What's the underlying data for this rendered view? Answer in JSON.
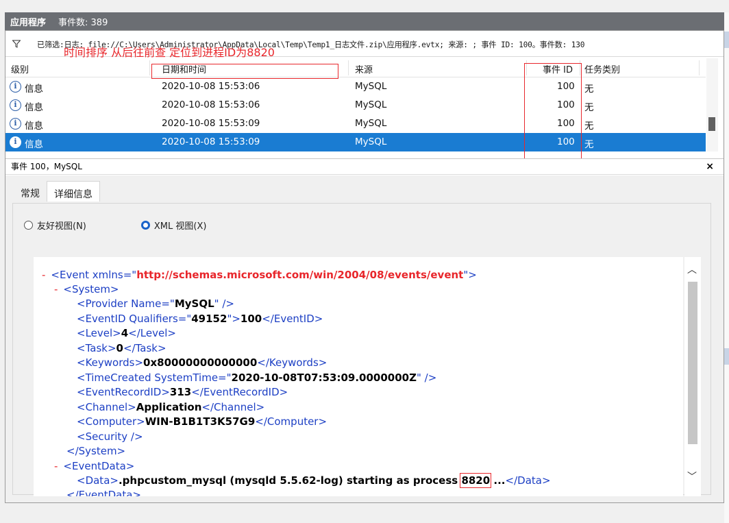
{
  "title": {
    "app": "应用程序",
    "count": "事件数: 389"
  },
  "filter": {
    "text": "已筛选:日志: file://C:\\Users\\Administrator\\AppData\\Local\\Temp\\Temp1_日志文件.zip\\应用程序.evtx; 来源: ; 事件 ID: 100。事件数: 130"
  },
  "annotation": {
    "note": "时间排序 从后往前查 定位到进程ID为8820"
  },
  "grid": {
    "columns": {
      "level": "级别",
      "datetime": "日期和时间",
      "source": "来源",
      "eventid": "事件 ID",
      "task": "任务类别"
    },
    "rows": [
      {
        "level": "信息",
        "datetime": "2020-10-08 15:53:06",
        "source": "MySQL",
        "eventid": "100",
        "task": "无"
      },
      {
        "level": "信息",
        "datetime": "2020-10-08 15:53:06",
        "source": "MySQL",
        "eventid": "100",
        "task": "无"
      },
      {
        "level": "信息",
        "datetime": "2020-10-08 15:53:09",
        "source": "MySQL",
        "eventid": "100",
        "task": "无"
      },
      {
        "level": "信息",
        "datetime": "2020-10-08 15:53:09",
        "source": "MySQL",
        "eventid": "100",
        "task": "无"
      }
    ]
  },
  "detail": {
    "header": "事件 100，MySQL",
    "close": "×",
    "tabs": [
      "常规",
      "详细信息"
    ],
    "radio_friendly": "友好视图(N)",
    "radio_xml": "XML 视图(X)"
  },
  "xml": {
    "l1_open": "<Event xmlns=\"",
    "l1_url": "http://schemas.microsoft.com/win/2004/08/events/event",
    "l1_close": "\">",
    "l2": "<System>",
    "l3_a": "<Provider Name=\"",
    "l3_v": "MySQL",
    "l3_b": "\" />",
    "l4_a": "<EventID Qualifiers=\"",
    "l4_v1": "49152",
    "l4_b": "\">",
    "l4_v2": "100",
    "l4_c": "</EventID>",
    "l5_a": "<Level>",
    "l5_v": "4",
    "l5_b": "</Level>",
    "l6_a": "<Task>",
    "l6_v": "0",
    "l6_b": "</Task>",
    "l7_a": "<Keywords>",
    "l7_v": "0x80000000000000",
    "l7_b": "</Keywords>",
    "l8_a": "<TimeCreated SystemTime=\"",
    "l8_v": "2020-10-08T07:53:09.0000000Z",
    "l8_b": "\" />",
    "l9_a": "<EventRecordID>",
    "l9_v": "313",
    "l9_b": "</EventRecordID>",
    "l10_a": "<Channel>",
    "l10_v": "Application",
    "l10_b": "</Channel>",
    "l11_a": "<Computer>",
    "l11_v": "WIN-B1B1T3K57G9",
    "l11_b": "</Computer>",
    "l12": "<Security />",
    "l13": "</System>",
    "l14": "<EventData>",
    "l15_a": "<Data>",
    "l15_v": ".phpcustom_mysql (mysqld 5.5.62-log) starting as process ",
    "l15_pid": "8820",
    "l15_tail": " ...",
    "l15_b": "</Data>",
    "l16": "</EventData>",
    "dash": "-"
  }
}
